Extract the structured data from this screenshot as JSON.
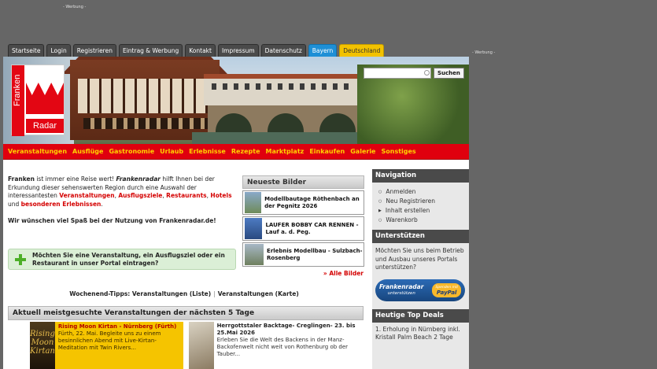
{
  "ads": {
    "top": "- Werbung -",
    "side": "- Werbung -"
  },
  "topnav": [
    "Startseite",
    "Login",
    "Registrieren",
    "Eintrag & Werbung",
    "Kontakt",
    "Impressum",
    "Datenschutz",
    "Bayern",
    "Deutschland"
  ],
  "logo": {
    "top": "Franken",
    "bottom": "Radar"
  },
  "search": {
    "value": "",
    "button": "Suchen"
  },
  "mainnav": [
    "Veranstaltungen",
    "Ausflüge",
    "Gastronomie",
    "Urlaub",
    "Erlebnisse",
    "Rezepte",
    "Marktplatz",
    "Einkaufen",
    "Galerie",
    "Sonstiges"
  ],
  "intro": {
    "w1": "Franken",
    "t1": " ist immer eine Reise wert! ",
    "w2": "Frankenradar",
    "t2": " hilft Ihnen bei der Erkundung dieser sehenswerten Region durch eine Auswahl der interessantesten ",
    "r1": "Veranstaltungen",
    "c1": ", ",
    "r2": "Ausflugsziele",
    "c2": ", ",
    "r3": "Restaurants",
    "c3": ", ",
    "r4": "Hotels",
    "t3": " und ",
    "r5": "besonderen Erlebnissen",
    "t4": ".",
    "wish": "Wir wünschen viel Spaß bei der Nutzung von Frankenradar.de!"
  },
  "cta": "Möchten Sie eine Veranstaltung, ein Ausflugsziel oder ein Restaurant in unser Portal eintragen?",
  "weekend": {
    "label": "Wochenend-Tipps: Veranstaltungen (Liste)",
    "sep": "|",
    "link2": "Veranstaltungen (Karte)"
  },
  "bilder": {
    "title": "Neueste Bilder",
    "entries": [
      "Modellbautage Röthenbach an der Pegnitz 2026",
      "LAUFER BOBBY CAR RENNEN - Lauf a. d. Peg.",
      "Erlebnis Modellbau - Sulzbach-Rosenberg"
    ],
    "more": "» Alle Bilder",
    "thumb_colors": [
      "#6e8b5a",
      "#345a9a",
      "#7a8f6b"
    ]
  },
  "aktuell": "Aktuell meistgesuchte Veranstaltungen der nächsten 5 Tage",
  "events": [
    {
      "thumb": "Rising Moon Kirtan",
      "title": "Rising Moon Kirtan - Nürnberg (Fürth)",
      "text": "Fürth, 22. Mai. Begleite uns zu einem besinnlichen Abend mit Live-Kirtan-Meditation mit Twin Rivers..."
    },
    {
      "title": "Herrgottstaler Backtage- Creglingen- 23. bis 25.Mai 2026",
      "text": "Erleben Sie die Welt des Backens in der Manz- Backofenwelt nicht weit von Rothenburg ob der Tauber..."
    }
  ],
  "sidebar": {
    "nav_title": "Navigation",
    "nav_items": [
      "Anmelden",
      "Neu Registrieren",
      "Inhalt erstellen",
      "Warenkorb"
    ],
    "support_title": "Unterstützen",
    "support_text": "Möchten Sie uns beim Betrieb und Ausbau unseres Portals unterstützen?",
    "paypal_left": "Frankenradar",
    "paypal_left_sub": "unterstützen",
    "paypal_right_small": "Spenden mit",
    "paypal_right": "PayPal",
    "deals_title": "Heutige Top Deals",
    "deals_text": "1. Erholung in Nürnberg inkl. Kristall Palm Beach 2 Tage"
  },
  "colors": {
    "nav_red": "#e0000e",
    "nav_text": "#ffd200",
    "accent_red": "#d40000",
    "bayern": "#1e8fd6",
    "deutschland": "#f2c200"
  }
}
